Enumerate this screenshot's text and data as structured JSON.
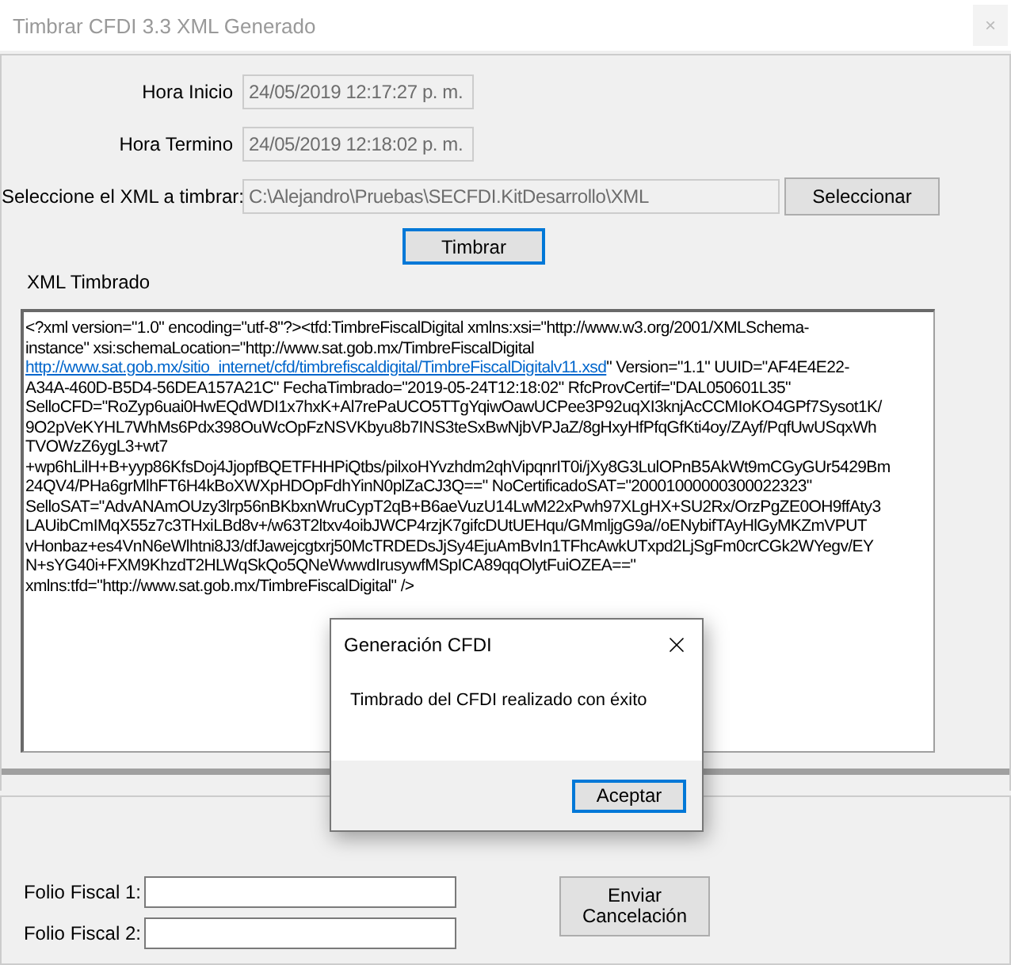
{
  "window": {
    "title": "Timbrar CFDI 3.3 XML Generado",
    "close": "×"
  },
  "fields": [
    {
      "label": "Hora Inicio",
      "value": "24/05/2019 12:17:27 p. m."
    },
    {
      "label": "Hora Termino",
      "value": "24/05/2019 12:18:02 p. m."
    }
  ],
  "file": {
    "label": "Seleccione el XML a timbrar:",
    "value": "C:\\Alejandro\\Pruebas\\SECFDI.KitDesarrollo\\XML",
    "button": "Seleccionar"
  },
  "stamp_button": "Timbrar",
  "xml": {
    "label": "XML Timbrado",
    "lines": [
      [
        {
          "text": "<?xml version=\"1.0\" encoding=\"utf-8\"?><tfd:TimbreFiscalDigital xmlns:xsi=\"http://www.w3.org/2001/XMLSchema-"
        }
      ],
      [
        {
          "text": "instance\" xsi:schemaLocation=\"http://www.sat.gob.mx/TimbreFiscalDigital"
        }
      ],
      [
        {
          "text": "http://www.sat.gob.mx/sitio_internet/cfd/timbrefiscaldigital/TimbreFiscalDigitalv11.xsd",
          "kind": "link"
        },
        {
          "text": "\" Version=\"1.1\" UUID=\"AF4E4E22-"
        }
      ],
      [
        {
          "text": "A34A-460D-B5D4-56DEA157A21C\" FechaTimbrado=\"2019-05-24T12:18:02\" RfcProvCertif=\"DAL050601L35\""
        }
      ],
      [
        {
          "text": "SelloCFD=\"RoZyp6uai0HwEQdWDI1x7hxK+Al7rePaUCO5TTgYqiwOawUCPee3P92uqXI3knjAcCCMIoKO4GPf7Sysot1K/"
        }
      ],
      [
        {
          "text": "9O2pVeKYHL7WhMs6Pdx398OuWcOpFzNSVKbyu8b7INS3teSxBwNjbVPJaZ/8gHxyHfPfqGfKti4oy/ZAyf/PqfUwUSqxWh"
        }
      ],
      [
        {
          "text": "TVOWzZ6ygL3+wt7"
        }
      ],
      [
        {
          "text": "+wp6hLilH+B+yyp86KfsDoj4JjopfBQETFHHPiQtbs/pilxoHYvzhdm2qhVipqnrIT0i/jXy8G3LulOPnB5AkWt9mCGyGUr5429Bm"
        }
      ],
      [
        {
          "text": "24QV4/PHa6grMlhFT6H4kBoXWXpHDOpFdhYinN0plZaCJ3Q==\" NoCertificadoSAT=\"20001000000300022323\""
        }
      ],
      [
        {
          "text": "SelloSAT=\"AdvANAmOUzy3lrp56nBKbxnWruCypT2qB+B6aeVuzU14LwM22xPwh97XLgHX+SU2Rx/OrzPgZE0OH9ffAty3"
        }
      ],
      [
        {
          "text": "LAUibCmIMqX55z7c3THxiLBd8v+/w63T2ltxv4oibJWCP4rzjK7gifcDUtUEHqu/GMmljgG9a//oENybifTAyHlGyMKZmVPUT"
        }
      ],
      [
        {
          "text": "vHonbaz+es4VnN6eWlhtni8J3/dfJawejcgtxrj50McTRDEDsJjSy4EjuAmBvIn1TFhcAwkUTxpd2LjSgFm0crCGk2WYegv/EY"
        }
      ],
      [
        {
          "text": "N+sYG40i+FXM9KhzdT2HLWqSkQo5QNeWwwdIrusywfMSpICA89qqOlytFuiOZEA==\""
        }
      ],
      [
        {
          "text": "xmlns:tfd=\"http://www.sat.gob.mx/TimbreFiscalDigital\" />"
        }
      ]
    ]
  },
  "cancel": {
    "fields": [
      {
        "label": "Folio Fiscal 1:"
      },
      {
        "label": "Folio Fiscal 2:"
      }
    ],
    "button": [
      "Enviar",
      "Cancelación"
    ]
  },
  "dialog": {
    "title": "Generación CFDI",
    "message": "Timbrado del CFDI realizado con éxito",
    "button": "Aceptar"
  }
}
